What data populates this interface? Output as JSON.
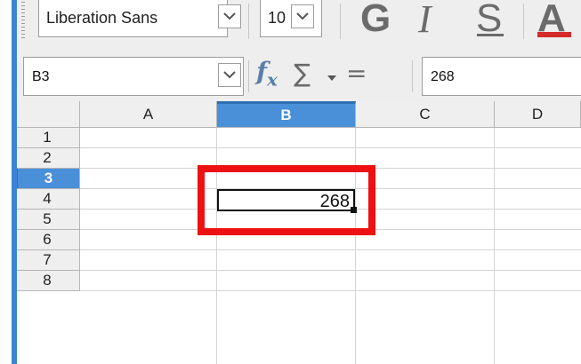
{
  "toolbar": {
    "font_name": "Liberation Sans",
    "font_size": "10",
    "bold_label": "G",
    "italic_label": "I",
    "underline_label": "S",
    "font_color_label": "A",
    "font_color": "#d42a2a"
  },
  "formula_bar": {
    "name_box": "B3",
    "function_wizard_icon": "fx-icon",
    "sum_icon": "sigma-icon",
    "formula_icon": "equals-icon",
    "input_value": "268"
  },
  "grid": {
    "columns": [
      "A",
      "B",
      "C",
      "D"
    ],
    "selected_column": "B",
    "rows": [
      "1",
      "2",
      "3",
      "4",
      "5",
      "6",
      "7",
      "8"
    ],
    "selected_row": "3",
    "active_cell": {
      "ref": "B3",
      "value": "268"
    }
  },
  "colors": {
    "accent": "#4a90d9",
    "highlight": "#ee1111"
  }
}
